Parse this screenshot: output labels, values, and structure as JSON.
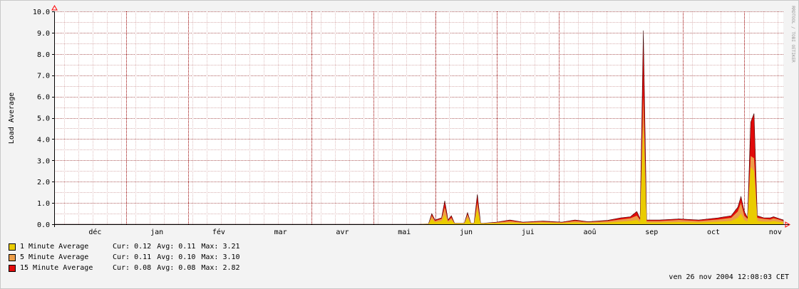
{
  "chart_data": {
    "type": "area",
    "ylabel": "Load Average",
    "watermark": "RRDTOOL / TOBI OETIKER",
    "ylim": [
      0,
      10
    ],
    "y_ticks": [
      "0.0",
      "1.0",
      "2.0",
      "3.0",
      "4.0",
      "5.0",
      "6.0",
      "7.0",
      "8.0",
      "9.0",
      "10.0"
    ],
    "x_ticks": [
      "déc",
      "jan",
      "fév",
      "mar",
      "avr",
      "mai",
      "jun",
      "jui",
      "aoû",
      "sep",
      "oct",
      "nov"
    ],
    "grid": true,
    "colors": {
      "background": "#ffffff",
      "canvas": "#f3f3f3",
      "grid_minor": "#e0a0a0",
      "grid_major": "#990000",
      "axis_arrow": "#ff0000"
    },
    "series": [
      {
        "name": "15 Minute Average",
        "color": "#e10b0b",
        "cur": "0.08",
        "avg": "0.08",
        "max": "2.82",
        "points": [
          [
            0,
            0
          ],
          [
            0.56,
            0
          ],
          [
            0.575,
            0.02
          ],
          [
            0.58,
            0.5
          ],
          [
            0.585,
            0.2
          ],
          [
            0.595,
            0.3
          ],
          [
            0.6,
            1.1
          ],
          [
            0.605,
            0.2
          ],
          [
            0.61,
            0.4
          ],
          [
            0.615,
            0.05
          ],
          [
            0.63,
            0.05
          ],
          [
            0.635,
            0.55
          ],
          [
            0.64,
            0.05
          ],
          [
            0.645,
            0.05
          ],
          [
            0.65,
            1.4
          ],
          [
            0.655,
            0.05
          ],
          [
            0.66,
            0.05
          ],
          [
            0.68,
            0.1
          ],
          [
            0.7,
            0.2
          ],
          [
            0.72,
            0.1
          ],
          [
            0.75,
            0.15
          ],
          [
            0.78,
            0.1
          ],
          [
            0.8,
            0.2
          ],
          [
            0.82,
            0.12
          ],
          [
            0.85,
            0.18
          ],
          [
            0.87,
            0.3
          ],
          [
            0.885,
            0.35
          ],
          [
            0.895,
            0.6
          ],
          [
            0.9,
            0.25
          ],
          [
            0.905,
            9.1
          ],
          [
            0.91,
            0.2
          ],
          [
            0.93,
            0.2
          ],
          [
            0.96,
            0.25
          ],
          [
            0.99,
            0.2
          ],
          [
            1.02,
            0.3
          ],
          [
            1.04,
            0.4
          ],
          [
            1.05,
            0.8
          ],
          [
            1.055,
            1.3
          ],
          [
            1.06,
            0.6
          ],
          [
            1.065,
            0.3
          ],
          [
            1.07,
            4.8
          ],
          [
            1.075,
            5.2
          ],
          [
            1.08,
            0.4
          ],
          [
            1.09,
            0.3
          ],
          [
            1.1,
            0.3
          ],
          [
            1.105,
            0.35
          ],
          [
            1.115,
            0.25
          ],
          [
            1.12,
            0.2
          ]
        ]
      },
      {
        "name": "5 Minute Average",
        "color": "#ec9d48",
        "cur": "0.11",
        "avg": "0.10",
        "max": "3.10",
        "points": [
          [
            0,
            0
          ],
          [
            0.56,
            0
          ],
          [
            0.575,
            0.02
          ],
          [
            0.58,
            0.4
          ],
          [
            0.585,
            0.15
          ],
          [
            0.595,
            0.25
          ],
          [
            0.6,
            0.8
          ],
          [
            0.605,
            0.15
          ],
          [
            0.61,
            0.3
          ],
          [
            0.615,
            0.05
          ],
          [
            0.63,
            0.05
          ],
          [
            0.635,
            0.45
          ],
          [
            0.64,
            0.05
          ],
          [
            0.645,
            0.05
          ],
          [
            0.65,
            1.0
          ],
          [
            0.655,
            0.05
          ],
          [
            0.66,
            0.05
          ],
          [
            0.68,
            0.08
          ],
          [
            0.7,
            0.15
          ],
          [
            0.72,
            0.08
          ],
          [
            0.75,
            0.12
          ],
          [
            0.78,
            0.08
          ],
          [
            0.8,
            0.15
          ],
          [
            0.82,
            0.1
          ],
          [
            0.85,
            0.14
          ],
          [
            0.87,
            0.22
          ],
          [
            0.885,
            0.28
          ],
          [
            0.895,
            0.4
          ],
          [
            0.9,
            0.2
          ],
          [
            0.905,
            6.0
          ],
          [
            0.91,
            0.15
          ],
          [
            0.93,
            0.15
          ],
          [
            0.96,
            0.2
          ],
          [
            0.99,
            0.15
          ],
          [
            1.02,
            0.22
          ],
          [
            1.04,
            0.3
          ],
          [
            1.05,
            0.6
          ],
          [
            1.055,
            1.0
          ],
          [
            1.06,
            0.4
          ],
          [
            1.065,
            0.25
          ],
          [
            1.07,
            3.2
          ],
          [
            1.075,
            3.1
          ],
          [
            1.08,
            0.3
          ],
          [
            1.09,
            0.25
          ],
          [
            1.1,
            0.22
          ],
          [
            1.105,
            0.28
          ],
          [
            1.115,
            0.2
          ],
          [
            1.12,
            0.15
          ]
        ]
      },
      {
        "name": "1 Minute Average",
        "color": "#eacc00",
        "cur": "0.12",
        "avg": "0.11",
        "max": "3.21",
        "points": [
          [
            0,
            0
          ],
          [
            0.56,
            0
          ],
          [
            0.575,
            0.01
          ],
          [
            0.58,
            0.25
          ],
          [
            0.585,
            0.1
          ],
          [
            0.595,
            0.15
          ],
          [
            0.6,
            0.45
          ],
          [
            0.605,
            0.1
          ],
          [
            0.61,
            0.2
          ],
          [
            0.615,
            0.03
          ],
          [
            0.63,
            0.03
          ],
          [
            0.635,
            0.3
          ],
          [
            0.64,
            0.03
          ],
          [
            0.645,
            0.03
          ],
          [
            0.65,
            0.7
          ],
          [
            0.655,
            0.03
          ],
          [
            0.66,
            0.03
          ],
          [
            0.68,
            0.05
          ],
          [
            0.7,
            0.08
          ],
          [
            0.72,
            0.05
          ],
          [
            0.75,
            0.07
          ],
          [
            0.78,
            0.05
          ],
          [
            0.8,
            0.08
          ],
          [
            0.82,
            0.06
          ],
          [
            0.85,
            0.08
          ],
          [
            0.87,
            0.12
          ],
          [
            0.885,
            0.15
          ],
          [
            0.895,
            0.2
          ],
          [
            0.9,
            0.1
          ],
          [
            0.905,
            4.7
          ],
          [
            0.91,
            0.08
          ],
          [
            0.93,
            0.08
          ],
          [
            0.96,
            0.1
          ],
          [
            0.99,
            0.08
          ],
          [
            1.02,
            0.12
          ],
          [
            1.04,
            0.15
          ],
          [
            1.05,
            0.3
          ],
          [
            1.055,
            0.5
          ],
          [
            1.06,
            0.2
          ],
          [
            1.065,
            0.12
          ],
          [
            1.07,
            2.7
          ],
          [
            1.075,
            2.5
          ],
          [
            1.08,
            0.15
          ],
          [
            1.09,
            0.12
          ],
          [
            1.1,
            0.12
          ],
          [
            1.105,
            0.15
          ],
          [
            1.115,
            0.1
          ],
          [
            1.12,
            0.08
          ]
        ]
      }
    ],
    "legend": [
      {
        "name": "1 Minute Average",
        "color": "#eacc00",
        "cur": "Cur: 0.12",
        "avg": "Avg: 0.11",
        "max": "Max: 3.21"
      },
      {
        "name": "5 Minute Average",
        "color": "#ec9d48",
        "cur": "Cur: 0.11",
        "avg": "Avg: 0.10",
        "max": "Max: 3.10"
      },
      {
        "name": "15 Minute Average",
        "color": "#e10b0b",
        "cur": "Cur: 0.08",
        "avg": "Avg: 0.08",
        "max": "Max: 2.82"
      }
    ],
    "timestamp": "ven 26 nov 2004 12:08:03 CET"
  }
}
